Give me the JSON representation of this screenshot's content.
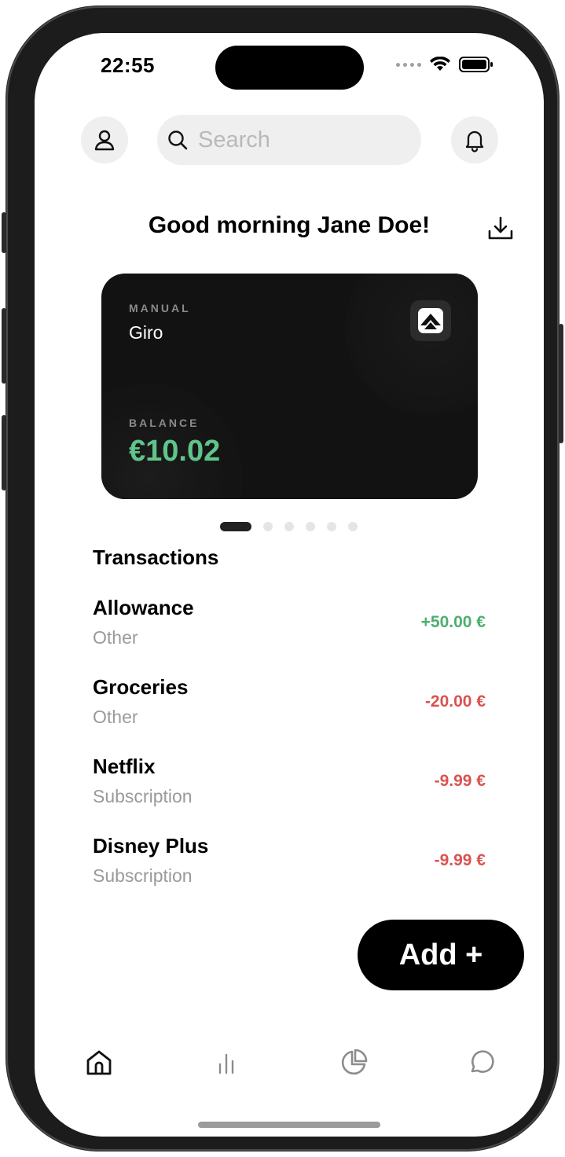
{
  "status_bar": {
    "time": "22:55"
  },
  "header": {
    "profile_icon": "person-icon",
    "search_placeholder": "Search",
    "search_value": "",
    "notifications_icon": "bell-icon"
  },
  "greeting": "Good morning Jane Doe!",
  "download_icon": "download-icon",
  "card": {
    "type_label": "MANUAL",
    "account_name": "Giro",
    "balance_label": "BALANCE",
    "balance": "€10.02",
    "logo_icon": "bank-logo-icon",
    "balance_color": "#5fc48a"
  },
  "pager": {
    "count": 6,
    "active_index": 0
  },
  "transactions": {
    "title": "Transactions",
    "items": [
      {
        "name": "Allowance",
        "category": "Other",
        "amount": "+50.00 €",
        "color": "#4caf6e"
      },
      {
        "name": "Groceries",
        "category": "Other",
        "amount": "-20.00 €",
        "color": "#d9534f"
      },
      {
        "name": "Netflix",
        "category": "Subscription",
        "amount": "-9.99 €",
        "color": "#d9534f"
      },
      {
        "name": "Disney Plus",
        "category": "Subscription",
        "amount": "-9.99 €",
        "color": "#d9534f"
      }
    ]
  },
  "add_button": {
    "label": "Add +"
  },
  "tabbar": {
    "items": [
      {
        "icon": "home-icon",
        "active": true
      },
      {
        "icon": "bar-chart-icon",
        "active": false
      },
      {
        "icon": "pie-chart-icon",
        "active": false
      },
      {
        "icon": "chat-bubble-icon",
        "active": false
      }
    ]
  }
}
